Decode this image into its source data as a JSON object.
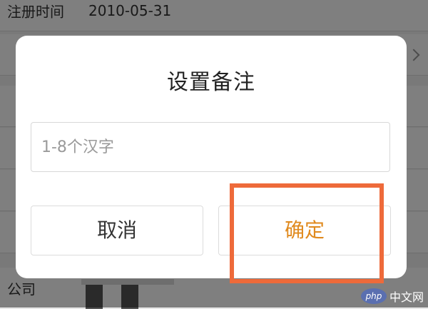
{
  "background": {
    "register_label": "注册时间",
    "register_date": "2010-05-31",
    "company_label": "公司"
  },
  "dialog": {
    "title": "设置备注",
    "input": {
      "value": "",
      "placeholder": "1-8个汉字"
    },
    "cancel_label": "取消",
    "confirm_label": "确定"
  },
  "watermark": {
    "logo_text": "php",
    "site_text": "中文网"
  },
  "colors": {
    "highlight": "#ee6a3a",
    "confirm_text": "#e08a1e"
  }
}
